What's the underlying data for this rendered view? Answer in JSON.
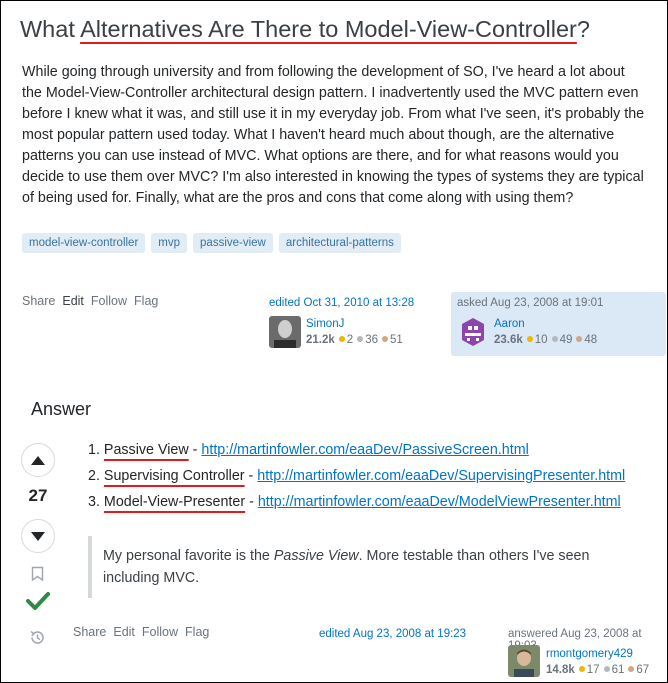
{
  "question": {
    "title": "What Alternatives Are There to Model-View-Controller?",
    "title_plain": "What ",
    "title_underlined": "Alternatives Are There to Model-View-Controller",
    "title_end": "?",
    "body": "While going through university and from following the development of SO, I've heard a lot about the Model-View-Controller architectural design pattern. I inadvertently used the MVC pattern even before I knew what it was, and still use it in my everyday job. From what I've seen, it's probably the most popular pattern used today. What I haven't heard much about though, are the alternative patterns you can use instead of MVC. What options are there, and for what reasons would you decide to use them over MVC? I'm also interested in knowing the types of systems they are typical of being used for. Finally, what are the pros and cons that come along with using them?",
    "tags": [
      "model-view-controller",
      "mvp",
      "passive-view",
      "architectural-patterns"
    ],
    "menu": {
      "share": "Share",
      "edit": "Edit",
      "follow": "Follow",
      "flag": "Flag"
    },
    "editor": {
      "action": "edited Oct 31, 2010 at 13:28",
      "name": "SimonJ",
      "rep": "21.2k",
      "gold": "2",
      "silver": "36",
      "bronze": "51"
    },
    "asker": {
      "action": "asked Aug 23, 2008 at 19:01",
      "name": "Aaron",
      "rep": "23.6k",
      "gold": "10",
      "silver": "49",
      "bronze": "48"
    }
  },
  "answers_heading": "Answer",
  "answer": {
    "score": "27",
    "items": [
      {
        "num": "1.",
        "name": "Passive View",
        "sep": " - ",
        "url": "http://martinfowler.com/eaaDev/PassiveScreen.html"
      },
      {
        "num": "2.",
        "name": "Supervising Controller",
        "sep": " - ",
        "url": "http://martinfowler.com/eaaDev/SupervisingPresenter.html"
      },
      {
        "num": "3.",
        "name": "Model-View-Presenter",
        "sep": " - ",
        "url": "http://martinfowler.com/eaaDev/ModelViewPresenter.html"
      }
    ],
    "quote_before": "My personal favorite is the ",
    "quote_em": "Passive View",
    "quote_after": ". More testable than others I've seen including MVC.",
    "menu": {
      "share": "Share",
      "edit": "Edit",
      "follow": "Follow",
      "flag": "Flag"
    },
    "edited": "edited Aug 23, 2008 at 19:23",
    "answerer": {
      "action": "answered Aug 23, 2008 at 19:03",
      "name": "rmontgomery429",
      "rep": "14.8k",
      "gold": "17",
      "silver": "61",
      "bronze": "67"
    }
  },
  "colors": {
    "accent": "#0074cc",
    "accepted": "#2f8a46",
    "underline": "#e01b1b",
    "tag_bg": "#e1ecf4",
    "owner_bg": "#dbe8f5"
  }
}
